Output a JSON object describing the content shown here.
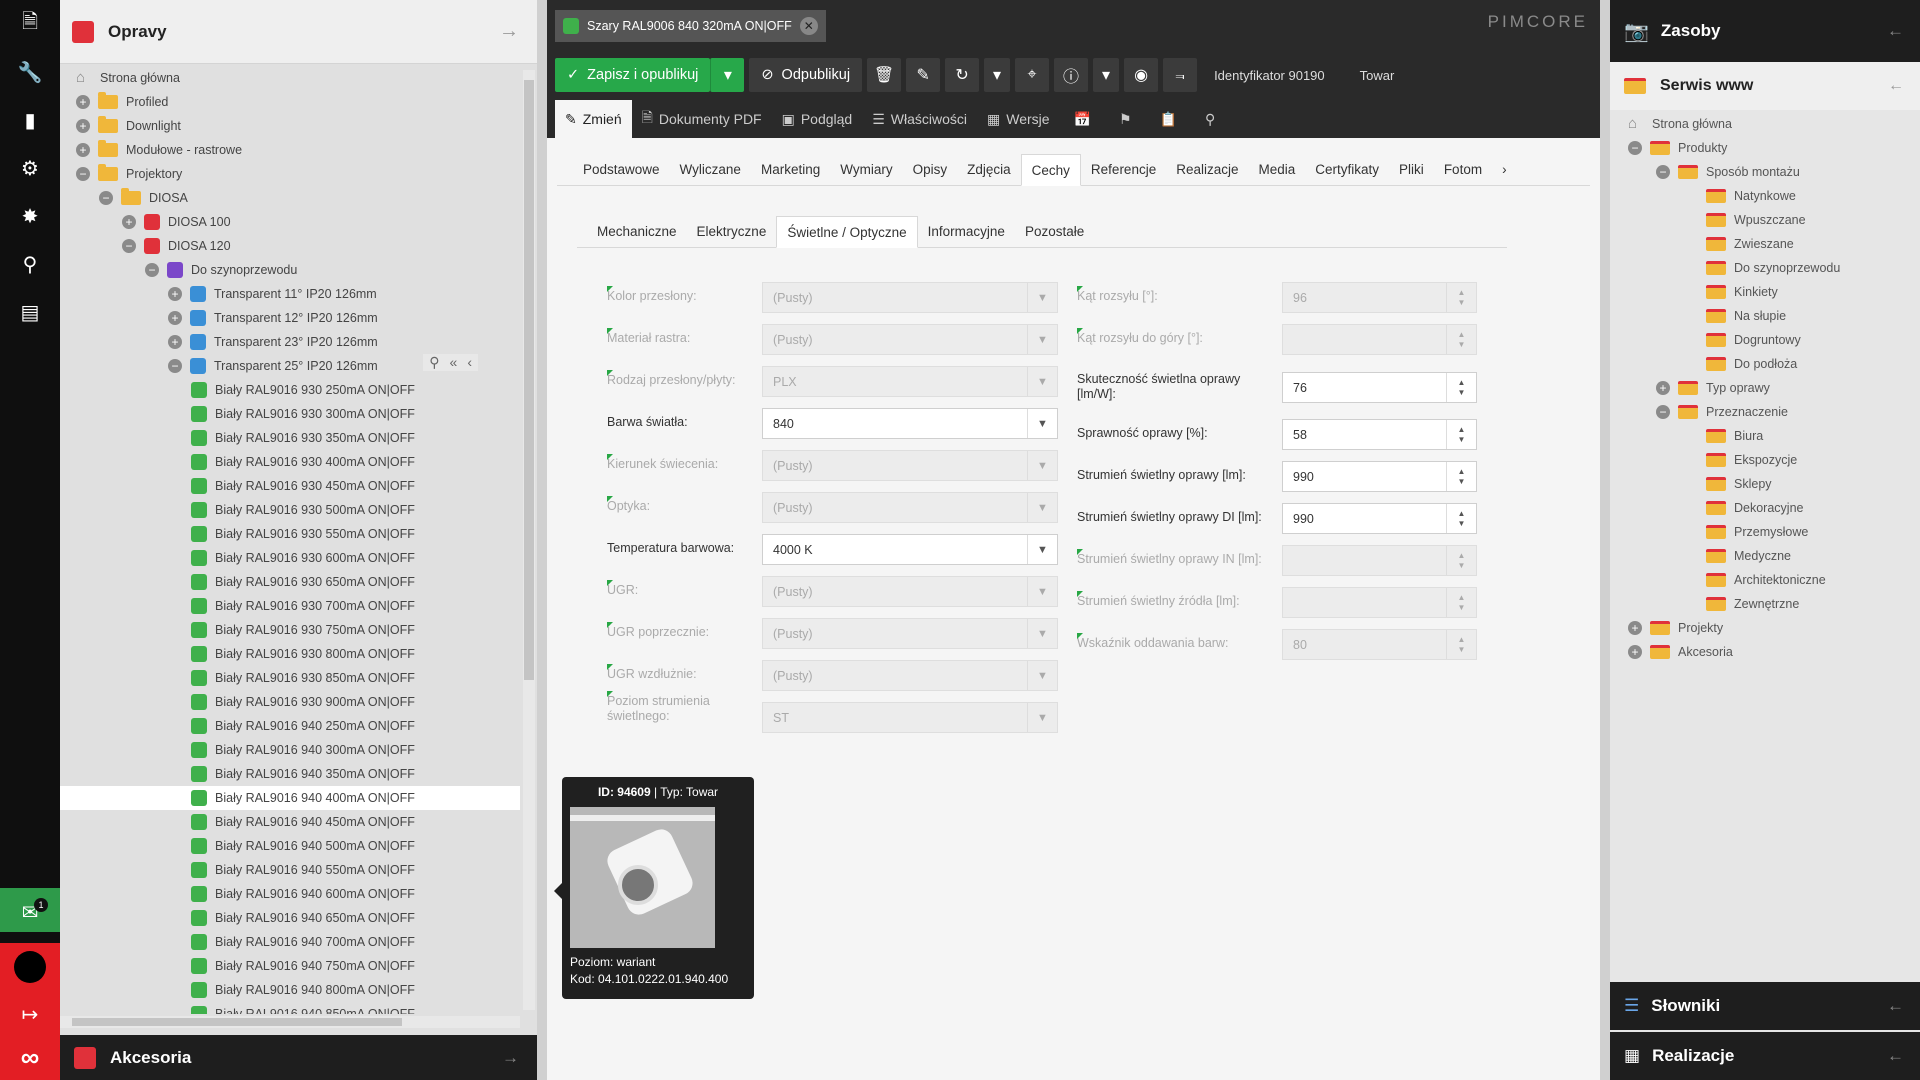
{
  "rail": {
    "chat_badge": "1"
  },
  "left": {
    "title": "Opravy",
    "footer": "Akcesoria",
    "tree": [
      {
        "label": "Strona główna",
        "level": 0,
        "kind": "home",
        "pm": ""
      },
      {
        "label": "Profiled",
        "level": 0,
        "kind": "folder",
        "pm": "+"
      },
      {
        "label": "Downlight",
        "level": 0,
        "kind": "folder",
        "pm": "+"
      },
      {
        "label": "Modułowe - rastrowe",
        "level": 0,
        "kind": "folder",
        "pm": "+"
      },
      {
        "label": "Projektory",
        "level": 0,
        "kind": "folder",
        "pm": "−"
      },
      {
        "label": "DIOSA",
        "level": 1,
        "kind": "folder",
        "pm": "−"
      },
      {
        "label": "DIOSA 100",
        "level": 2,
        "kind": "red",
        "pm": "+"
      },
      {
        "label": "DIOSA 120",
        "level": 2,
        "kind": "red",
        "pm": "−"
      },
      {
        "label": "Do szynoprzewodu",
        "level": 3,
        "kind": "purple",
        "pm": "−"
      },
      {
        "label": "Transparent 11° IP20 126mm",
        "level": 4,
        "kind": "blue",
        "pm": "+"
      },
      {
        "label": "Transparent 12° IP20 126mm",
        "level": 4,
        "kind": "blue",
        "pm": "+"
      },
      {
        "label": "Transparent 23° IP20 126mm",
        "level": 4,
        "kind": "blue",
        "pm": "+"
      },
      {
        "label": "Transparent 25° IP20 126mm",
        "level": 4,
        "kind": "blue",
        "pm": "−",
        "tools": true
      },
      {
        "label": "Biały RAL9016 930 250mA ON|OFF",
        "level": 5,
        "kind": "green",
        "pm": ""
      },
      {
        "label": "Biały RAL9016 930 300mA ON|OFF",
        "level": 5,
        "kind": "green",
        "pm": ""
      },
      {
        "label": "Biały RAL9016 930 350mA ON|OFF",
        "level": 5,
        "kind": "green",
        "pm": ""
      },
      {
        "label": "Biały RAL9016 930 400mA ON|OFF",
        "level": 5,
        "kind": "green",
        "pm": ""
      },
      {
        "label": "Biały RAL9016 930 450mA ON|OFF",
        "level": 5,
        "kind": "green",
        "pm": ""
      },
      {
        "label": "Biały RAL9016 930 500mA ON|OFF",
        "level": 5,
        "kind": "green",
        "pm": ""
      },
      {
        "label": "Biały RAL9016 930 550mA ON|OFF",
        "level": 5,
        "kind": "green",
        "pm": ""
      },
      {
        "label": "Biały RAL9016 930 600mA ON|OFF",
        "level": 5,
        "kind": "green",
        "pm": ""
      },
      {
        "label": "Biały RAL9016 930 650mA ON|OFF",
        "level": 5,
        "kind": "green",
        "pm": ""
      },
      {
        "label": "Biały RAL9016 930 700mA ON|OFF",
        "level": 5,
        "kind": "green",
        "pm": ""
      },
      {
        "label": "Biały RAL9016 930 750mA ON|OFF",
        "level": 5,
        "kind": "green",
        "pm": ""
      },
      {
        "label": "Biały RAL9016 930 800mA ON|OFF",
        "level": 5,
        "kind": "green",
        "pm": ""
      },
      {
        "label": "Biały RAL9016 930 850mA ON|OFF",
        "level": 5,
        "kind": "green",
        "pm": ""
      },
      {
        "label": "Biały RAL9016 930 900mA ON|OFF",
        "level": 5,
        "kind": "green",
        "pm": ""
      },
      {
        "label": "Biały RAL9016 940 250mA ON|OFF",
        "level": 5,
        "kind": "green",
        "pm": ""
      },
      {
        "label": "Biały RAL9016 940 300mA ON|OFF",
        "level": 5,
        "kind": "green",
        "pm": ""
      },
      {
        "label": "Biały RAL9016 940 350mA ON|OFF",
        "level": 5,
        "kind": "green",
        "pm": ""
      },
      {
        "label": "Biały RAL9016 940 400mA ON|OFF",
        "level": 5,
        "kind": "green",
        "pm": "",
        "selected": true
      },
      {
        "label": "Biały RAL9016 940 450mA ON|OFF",
        "level": 5,
        "kind": "green",
        "pm": ""
      },
      {
        "label": "Biały RAL9016 940 500mA ON|OFF",
        "level": 5,
        "kind": "green",
        "pm": ""
      },
      {
        "label": "Biały RAL9016 940 550mA ON|OFF",
        "level": 5,
        "kind": "green",
        "pm": ""
      },
      {
        "label": "Biały RAL9016 940 600mA ON|OFF",
        "level": 5,
        "kind": "green",
        "pm": ""
      },
      {
        "label": "Biały RAL9016 940 650mA ON|OFF",
        "level": 5,
        "kind": "green",
        "pm": ""
      },
      {
        "label": "Biały RAL9016 940 700mA ON|OFF",
        "level": 5,
        "kind": "green",
        "pm": ""
      },
      {
        "label": "Biały RAL9016 940 750mA ON|OFF",
        "level": 5,
        "kind": "green",
        "pm": ""
      },
      {
        "label": "Biały RAL9016 940 800mA ON|OFF",
        "level": 5,
        "kind": "green",
        "pm": ""
      },
      {
        "label": "Biały RAL9016 940 850mA ON|OFF",
        "level": 5,
        "kind": "green",
        "pm": ""
      }
    ]
  },
  "doc_tab": {
    "title": "Szary RAL9006 840 320mA ON|OFF"
  },
  "brand": "PIMCORE",
  "toolbar": {
    "save": "Zapisz i opublikuj",
    "unpublish": "Odpublikuj",
    "id_label": "Identyfikator 90190",
    "type_label": "Towar"
  },
  "tabs1": [
    "Zmień",
    "Dokumenty PDF",
    "Podgląd",
    "Właściwości",
    "Wersje"
  ],
  "tabs2": [
    "Podstawowe",
    "Wyliczane",
    "Marketing",
    "Wymiary",
    "Opisy",
    "Zdjęcia",
    "Cechy",
    "Referencje",
    "Realizacje",
    "Media",
    "Certyfikaty",
    "Pliki",
    "Fotom"
  ],
  "tabs3": [
    "Mechaniczne",
    "Elektryczne",
    "Świetlne / Optyczne",
    "Informacyjne",
    "Pozostałe"
  ],
  "left_fields": [
    {
      "label": "Kolor przesłony:",
      "value": "(Pusty)",
      "disabled": true
    },
    {
      "label": "Materiał rastra:",
      "value": "(Pusty)",
      "disabled": true
    },
    {
      "label": "Rodzaj przesłony/płyty:",
      "value": "PLX",
      "disabled": true
    },
    {
      "label": "Barwa światła:",
      "value": "840",
      "disabled": false
    },
    {
      "label": "Kierunek świecenia:",
      "value": "(Pusty)",
      "disabled": true
    },
    {
      "label": "Optyka:",
      "value": "(Pusty)",
      "disabled": true
    },
    {
      "label": "Temperatura barwowa:",
      "value": "4000 K",
      "disabled": false
    },
    {
      "label": "UGR:",
      "value": "(Pusty)",
      "disabled": true
    },
    {
      "label": "UGR poprzecznie:",
      "value": "(Pusty)",
      "disabled": true
    },
    {
      "label": "UGR wzdłużnie:",
      "value": "(Pusty)",
      "disabled": true
    },
    {
      "label": "Poziom strumienia świetlnego:",
      "value": "ST",
      "disabled": true
    }
  ],
  "right_fields": [
    {
      "label": "Kąt rozsyłu [°]:",
      "value": "96",
      "disabled": true
    },
    {
      "label": "Kąt rozsyłu do góry [°]:",
      "value": "",
      "disabled": true
    },
    {
      "label": "Skuteczność świetlna oprawy [lm/W]:",
      "value": "76",
      "disabled": false
    },
    {
      "label": "Sprawność oprawy [%]:",
      "value": "58",
      "disabled": false
    },
    {
      "label": "Strumień świetlny oprawy [lm]:",
      "value": "990",
      "disabled": false
    },
    {
      "label": "Strumień świetlny oprawy DI [lm]:",
      "value": "990",
      "disabled": false
    },
    {
      "label": "Strumień świetlny oprawy IN [lm]:",
      "value": "",
      "disabled": true
    },
    {
      "label": "Strumień świetlny źródła [lm]:",
      "value": "",
      "disabled": true
    },
    {
      "label": "Wskaźnik oddawania barw:",
      "value": "80",
      "disabled": true
    }
  ],
  "tooltip": {
    "id": "ID: 94609",
    "type": " | Typ: Towar",
    "level": "Poziom: wariant",
    "code": "Kod: 04.101.0222.01.940.400"
  },
  "right": {
    "title": "Zasoby",
    "sub": "Serwis www",
    "tree": [
      {
        "label": "Strona główna",
        "level": 0,
        "kind": "home",
        "pm": ""
      },
      {
        "label": "Produkty",
        "level": 0,
        "kind": "folder",
        "pm": "−"
      },
      {
        "label": "Sposób montażu",
        "level": 1,
        "kind": "folder",
        "pm": "−"
      },
      {
        "label": "Natynkowe",
        "level": 2,
        "kind": "folder",
        "pm": ""
      },
      {
        "label": "Wpuszczane",
        "level": 2,
        "kind": "folder",
        "pm": ""
      },
      {
        "label": "Zwieszane",
        "level": 2,
        "kind": "folder",
        "pm": ""
      },
      {
        "label": "Do szynoprzewodu",
        "level": 2,
        "kind": "folder",
        "pm": ""
      },
      {
        "label": "Kinkiety",
        "level": 2,
        "kind": "folder",
        "pm": ""
      },
      {
        "label": "Na słupie",
        "level": 2,
        "kind": "folder",
        "pm": ""
      },
      {
        "label": "Dogruntowy",
        "level": 2,
        "kind": "folder",
        "pm": ""
      },
      {
        "label": "Do podłoża",
        "level": 2,
        "kind": "folder",
        "pm": ""
      },
      {
        "label": "Typ oprawy",
        "level": 1,
        "kind": "folder",
        "pm": "+"
      },
      {
        "label": "Przeznaczenie",
        "level": 1,
        "kind": "folder",
        "pm": "−"
      },
      {
        "label": "Biura",
        "level": 2,
        "kind": "folder",
        "pm": ""
      },
      {
        "label": "Ekspozycje",
        "level": 2,
        "kind": "folder",
        "pm": ""
      },
      {
        "label": "Sklepy",
        "level": 2,
        "kind": "folder",
        "pm": ""
      },
      {
        "label": "Dekoracyjne",
        "level": 2,
        "kind": "folder",
        "pm": ""
      },
      {
        "label": "Przemysłowe",
        "level": 2,
        "kind": "folder",
        "pm": ""
      },
      {
        "label": "Medyczne",
        "level": 2,
        "kind": "folder",
        "pm": ""
      },
      {
        "label": "Architektoniczne",
        "level": 2,
        "kind": "folder",
        "pm": ""
      },
      {
        "label": "Zewnętrzne",
        "level": 2,
        "kind": "folder",
        "pm": ""
      },
      {
        "label": "Projekty",
        "level": 0,
        "kind": "folder",
        "pm": "+"
      },
      {
        "label": "Akcesoria",
        "level": 0,
        "kind": "folder",
        "pm": "+"
      }
    ],
    "dict": "Słowniki",
    "real": "Realizacje"
  }
}
